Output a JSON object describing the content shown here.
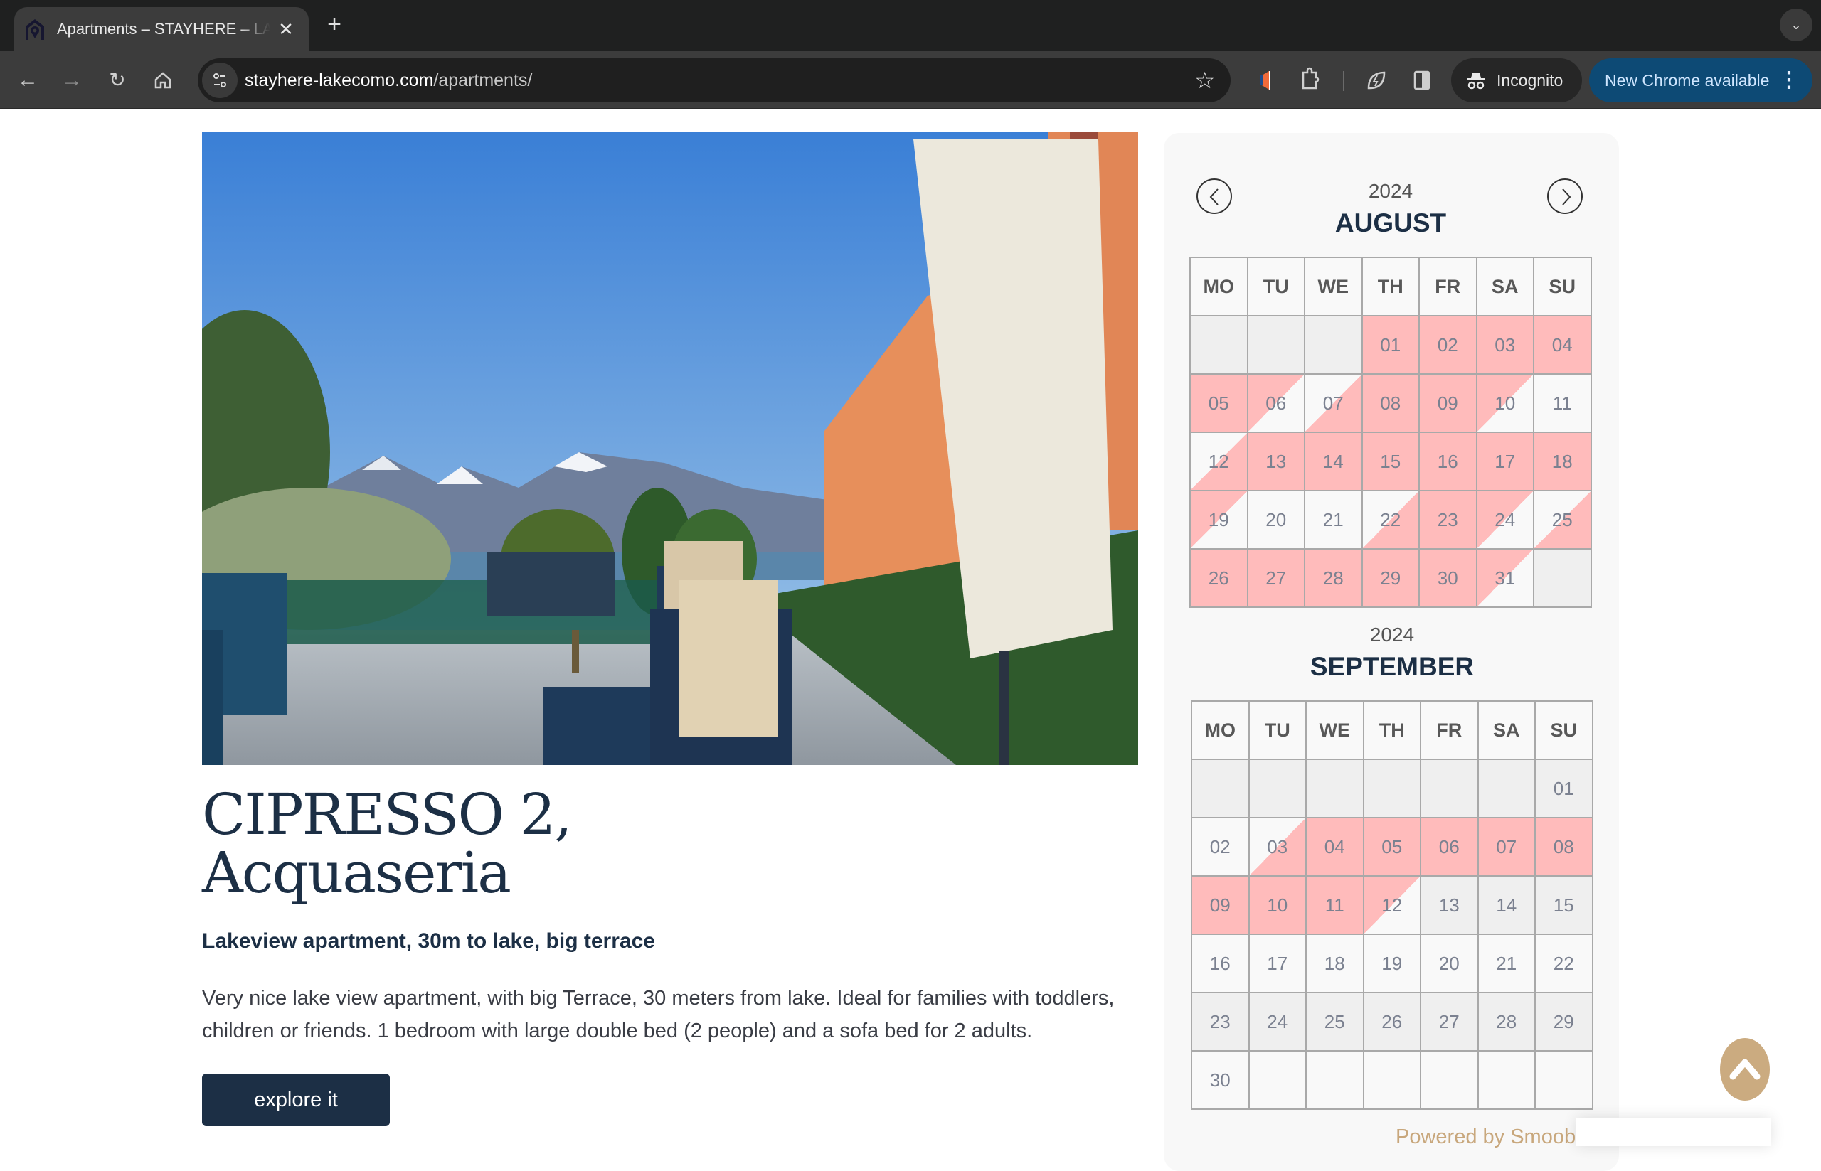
{
  "browser": {
    "tab_title": "Apartments – STAYHERE – LAKE COMO",
    "tab_close_icon": "close-icon",
    "new_tab_icon": "plus-icon",
    "tab_search_icon": "chevron-down-icon",
    "url_host": "stayhere-lakecomo.com",
    "url_path": "/apartments/",
    "incognito_label": "Incognito",
    "update_label": "New Chrome available",
    "menu_glyph": "⋮"
  },
  "listing": {
    "title_line1": "CIPRESSO 2,",
    "title_line2": "Acquaseria",
    "subtitle": "Lakeview apartment, 30m to lake, big terrace",
    "description": "Very nice lake view apartment, with big Terrace, 30 meters from lake. Ideal for families with toddlers, children or friends. 1 bedroom with large double bed (2 people) and a sofa bed for 2 adults.",
    "cta_label": "explore it",
    "photo_alt": "Terrace with chairs, table and lake & mountain view"
  },
  "calendar": {
    "weekdays": [
      "MO",
      "TU",
      "WE",
      "TH",
      "FR",
      "SA",
      "SU"
    ],
    "colors": {
      "booked": "#ffbbbb",
      "free": "#f9f9f9",
      "unavailable": "#efefef"
    },
    "months": [
      {
        "year": "2024",
        "name": "AUGUST",
        "weeks": [
          [
            {
              "d": "",
              "s": "empty"
            },
            {
              "d": "",
              "s": "empty"
            },
            {
              "d": "",
              "s": "empty"
            },
            {
              "d": "01",
              "s": "booked"
            },
            {
              "d": "02",
              "s": "booked"
            },
            {
              "d": "03",
              "s": "booked"
            },
            {
              "d": "04",
              "s": "booked"
            }
          ],
          [
            {
              "d": "05",
              "s": "booked"
            },
            {
              "d": "06",
              "s": "checkout"
            },
            {
              "d": "07",
              "s": "checkin"
            },
            {
              "d": "08",
              "s": "booked"
            },
            {
              "d": "09",
              "s": "booked"
            },
            {
              "d": "10",
              "s": "checkout"
            },
            {
              "d": "11",
              "s": "free"
            }
          ],
          [
            {
              "d": "12",
              "s": "checkin"
            },
            {
              "d": "13",
              "s": "booked"
            },
            {
              "d": "14",
              "s": "booked"
            },
            {
              "d": "15",
              "s": "booked"
            },
            {
              "d": "16",
              "s": "booked"
            },
            {
              "d": "17",
              "s": "booked"
            },
            {
              "d": "18",
              "s": "booked"
            }
          ],
          [
            {
              "d": "19",
              "s": "checkout"
            },
            {
              "d": "20",
              "s": "free"
            },
            {
              "d": "21",
              "s": "free"
            },
            {
              "d": "22",
              "s": "checkin"
            },
            {
              "d": "23",
              "s": "booked"
            },
            {
              "d": "24",
              "s": "checkout"
            },
            {
              "d": "25",
              "s": "checkin"
            }
          ],
          [
            {
              "d": "26",
              "s": "booked"
            },
            {
              "d": "27",
              "s": "booked"
            },
            {
              "d": "28",
              "s": "booked"
            },
            {
              "d": "29",
              "s": "booked"
            },
            {
              "d": "30",
              "s": "booked"
            },
            {
              "d": "31",
              "s": "checkout"
            },
            {
              "d": "",
              "s": "empty"
            }
          ]
        ]
      },
      {
        "year": "2024",
        "name": "SEPTEMBER",
        "weeks": [
          [
            {
              "d": "",
              "s": "empty"
            },
            {
              "d": "",
              "s": "empty"
            },
            {
              "d": "",
              "s": "empty"
            },
            {
              "d": "",
              "s": "empty"
            },
            {
              "d": "",
              "s": "empty"
            },
            {
              "d": "",
              "s": "empty"
            },
            {
              "d": "01",
              "s": "unavailable"
            }
          ],
          [
            {
              "d": "02",
              "s": "free"
            },
            {
              "d": "03",
              "s": "checkin"
            },
            {
              "d": "04",
              "s": "booked"
            },
            {
              "d": "05",
              "s": "booked"
            },
            {
              "d": "06",
              "s": "booked"
            },
            {
              "d": "07",
              "s": "booked"
            },
            {
              "d": "08",
              "s": "booked"
            }
          ],
          [
            {
              "d": "09",
              "s": "booked"
            },
            {
              "d": "10",
              "s": "booked"
            },
            {
              "d": "11",
              "s": "booked"
            },
            {
              "d": "12",
              "s": "checkout"
            },
            {
              "d": "13",
              "s": "unavailable"
            },
            {
              "d": "14",
              "s": "unavailable"
            },
            {
              "d": "15",
              "s": "unavailable"
            }
          ],
          [
            {
              "d": "16",
              "s": "free"
            },
            {
              "d": "17",
              "s": "free"
            },
            {
              "d": "18",
              "s": "free"
            },
            {
              "d": "19",
              "s": "free"
            },
            {
              "d": "20",
              "s": "free"
            },
            {
              "d": "21",
              "s": "free"
            },
            {
              "d": "22",
              "s": "free"
            }
          ],
          [
            {
              "d": "23",
              "s": "unavailable"
            },
            {
              "d": "24",
              "s": "unavailable"
            },
            {
              "d": "25",
              "s": "unavailable"
            },
            {
              "d": "26",
              "s": "unavailable"
            },
            {
              "d": "27",
              "s": "unavailable"
            },
            {
              "d": "28",
              "s": "unavailable"
            },
            {
              "d": "29",
              "s": "unavailable"
            }
          ],
          [
            {
              "d": "30",
              "s": "free"
            },
            {
              "d": "",
              "s": "free"
            },
            {
              "d": "",
              "s": "free"
            },
            {
              "d": "",
              "s": "free"
            },
            {
              "d": "",
              "s": "free"
            },
            {
              "d": "",
              "s": "free"
            },
            {
              "d": "",
              "s": "free"
            }
          ]
        ]
      }
    ],
    "powered_by": "Powered by Smoob"
  }
}
